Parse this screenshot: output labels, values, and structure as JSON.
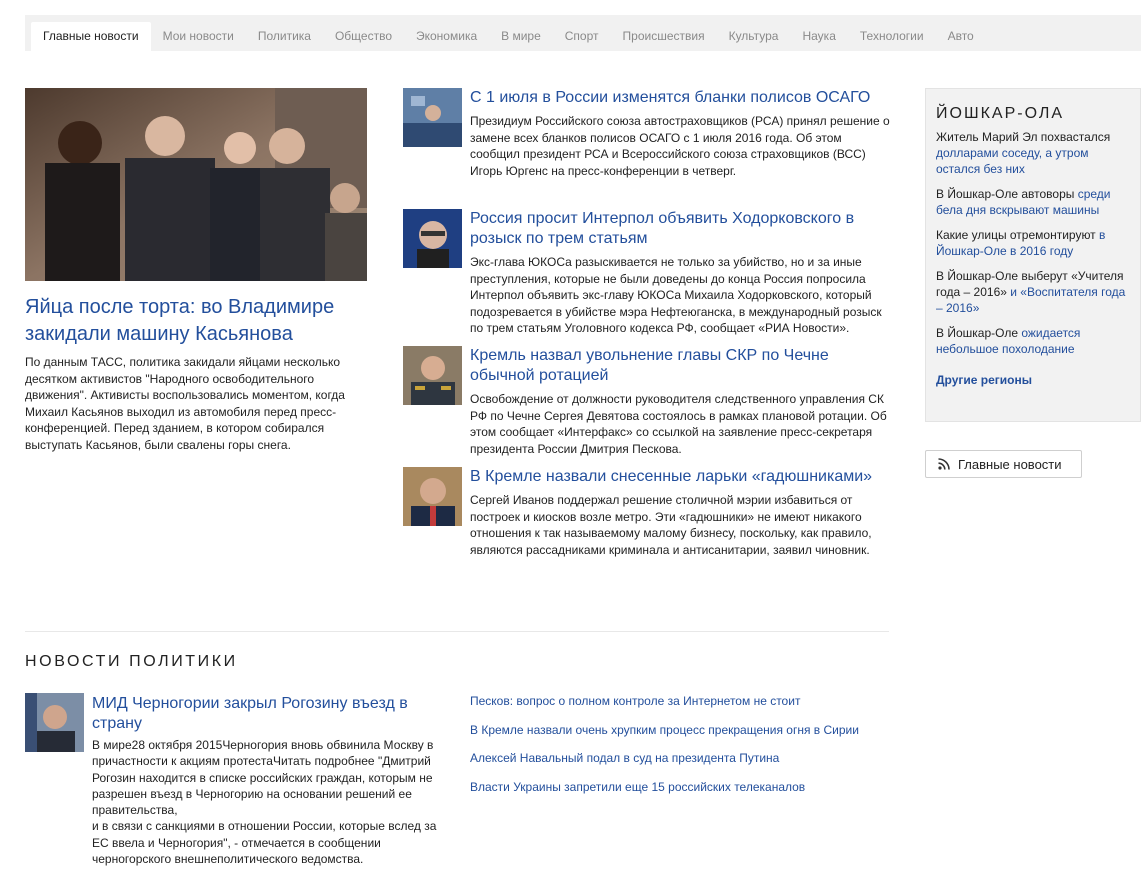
{
  "nav": {
    "tabs": [
      {
        "label": "Главные новости",
        "active": true
      },
      {
        "label": "Мои новости"
      },
      {
        "label": "Политика"
      },
      {
        "label": "Общество"
      },
      {
        "label": "Экономика"
      },
      {
        "label": "В мире"
      },
      {
        "label": "Спорт"
      },
      {
        "label": "Происшествия"
      },
      {
        "label": "Культура"
      },
      {
        "label": "Наука"
      },
      {
        "label": "Технологии"
      },
      {
        "label": "Авто"
      }
    ]
  },
  "lead": {
    "title": "Яйца после торта: во Владимире закидали машину Касьянова",
    "text": "По данным ТАСС, политика закидали яйцами несколько десятком активистов \"Народного освободительного движения\". Активисты воспользовались моментом, когда Михаил Касьянов выходил из автомобиля перед пресс-конференцией. Перед зданием, в котором собирался выступать Касьянов, были свалены горы снега."
  },
  "news": [
    {
      "title": "С 1 июля в России изменятся бланки полисов ОСАГО",
      "text": "Президиум Российского союза автостраховщиков (РСА) принял решение о замене всех бланков полисов ОСАГО с 1 июля 2016 года. Об этом сообщил президент РСА и Всероссийского союза страховщиков (ВСС) Игорь Юргенс на пресс-конференции в четверг."
    },
    {
      "title": "Россия просит Интерпол объявить Ходорковского в розыск по трем статьям",
      "text": "Экс-глава ЮКОСа разыскивается не только за убийство, но и за иные преступления, которые не были доведены до конца Россия попросила Интерпол объявить экс-главу ЮКОСа Михаила Ходорковского, который подозревается в убийстве мэра Нефтеюганска, в международный розыск по трем статьям Уголовного кодекса РФ, сообщает «РИА Новости»."
    },
    {
      "title": "Кремль назвал увольнение главы СКР по Чечне обычной ротацией",
      "text": "Освобождение от должности руководителя следственного управления СК РФ по Чечне Сергея Девятова состоялось в рамках плановой ротации. Об этом сообщает «Интерфакс» со ссылкой на заявление пресс-секретаря президента России Дмитрия Пескова."
    },
    {
      "title": "В Кремле назвали снесенные ларьки «гадюшниками»",
      "text": "Сергей Иванов поддержал решение столичной мэрии избавиться от построек и киосков возле метро. Эти «гадюшники» не имеют никакого отношения к так называемому малому бизнесу, поскольку, как правило, являются рассадниками криминала и антисанитарии, заявил чиновник."
    }
  ],
  "region": {
    "title": "ЙОШКАР-ОЛА",
    "items": [
      {
        "plain": "Житель Марий Эл похвастался ",
        "link": "долларами соседу, а утром остался без них"
      },
      {
        "plain": "В Йошкар-Оле автоворы ",
        "link": "среди бела дня вскрывают машины"
      },
      {
        "plain": "Какие улицы отремонтируют ",
        "link": "в Йошкар-Оле в 2016 году"
      },
      {
        "plain": "В Йошкар-Оле выберут «Учителя года – 2016» ",
        "link": "и «Воспитателя года – 2016»"
      },
      {
        "plain": "В Йошкар-Оле ",
        "link": "ожидается небольшое похолодание"
      }
    ],
    "more": "Другие регионы"
  },
  "rss": {
    "label": "Главные новости"
  },
  "politics": {
    "section_title": "НОВОСТИ ПОЛИТИКИ",
    "main_title": "МИД Черногории закрыл Рогозину въезд в страну",
    "main_text": "В мире28 октября 2015Черногория вновь обвинила Москву в причастности к акциям протестаЧитать подробнее \"Дмитрий Рогозин находится в списке российских граждан, которым не разрешен въезд в Черногорию на основании решений ее правительства,\nи в связи с санкциями в отношении России, которые вслед за ЕС ввела и Черногория\", - отмечается в сообщении черногорского внешнеполитического ведомства.",
    "links": [
      "Песков: вопрос о полном контроле за Интернетом не стоит",
      "В Кремле назвали очень хрупким процесс прекращения огня в Сирии",
      "Алексей Навальный подал в суд на президента Путина",
      "Власти Украины запретили еще 15 российских телеканалов"
    ]
  },
  "colors": {
    "link": "#234f9c",
    "nav_bg": "#f1f1f1",
    "sidebar_bg": "#f2f2f2"
  }
}
